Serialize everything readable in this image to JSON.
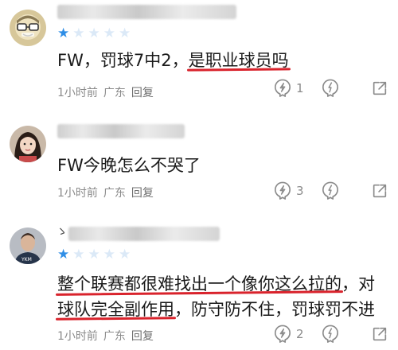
{
  "comments": [
    {
      "username": "",
      "rating": 1,
      "max_rating": 5,
      "lines": [
        {
          "plain": "FW，罚球7中2，",
          "underlined": "是职业球员吗",
          "rest": ""
        }
      ],
      "time": "1小时前",
      "location": "广东",
      "reply_label": "回复",
      "like_count": "1",
      "avatar_icon": "avatar-glasses-cartoon-icon"
    },
    {
      "username": "",
      "lines": [
        {
          "plain": "FW今晚怎么不哭了",
          "underlined": "",
          "rest": ""
        }
      ],
      "time": "1小时前",
      "location": "广东",
      "reply_label": "回复",
      "like_count": "3",
      "avatar_icon": "avatar-girl-photo-icon"
    },
    {
      "username_prefix": "ゝ",
      "username": "",
      "rating": 1,
      "max_rating": 5,
      "lines": [
        {
          "plain": "",
          "underlined": "整个联赛都很难找出一个像你这么拉的",
          "rest": "，对"
        },
        {
          "plain": "",
          "underlined": "球队完全副作用",
          "rest": "，防守防不住，罚球罚不进"
        }
      ],
      "time": "1小时前",
      "location": "广东",
      "reply_label": "回复",
      "like_count": "2",
      "avatar_icon": "avatar-player-photo-icon"
    }
  ],
  "colors": {
    "star_filled": "#2f8ee6",
    "star_empty": "#dbe9f7",
    "underline": "#d9232c",
    "meta_text": "#8b8b8b"
  },
  "icons": {
    "like": "thumb-like-icon",
    "dislike": "thumb-dislike-icon",
    "share": "share-out-icon"
  }
}
